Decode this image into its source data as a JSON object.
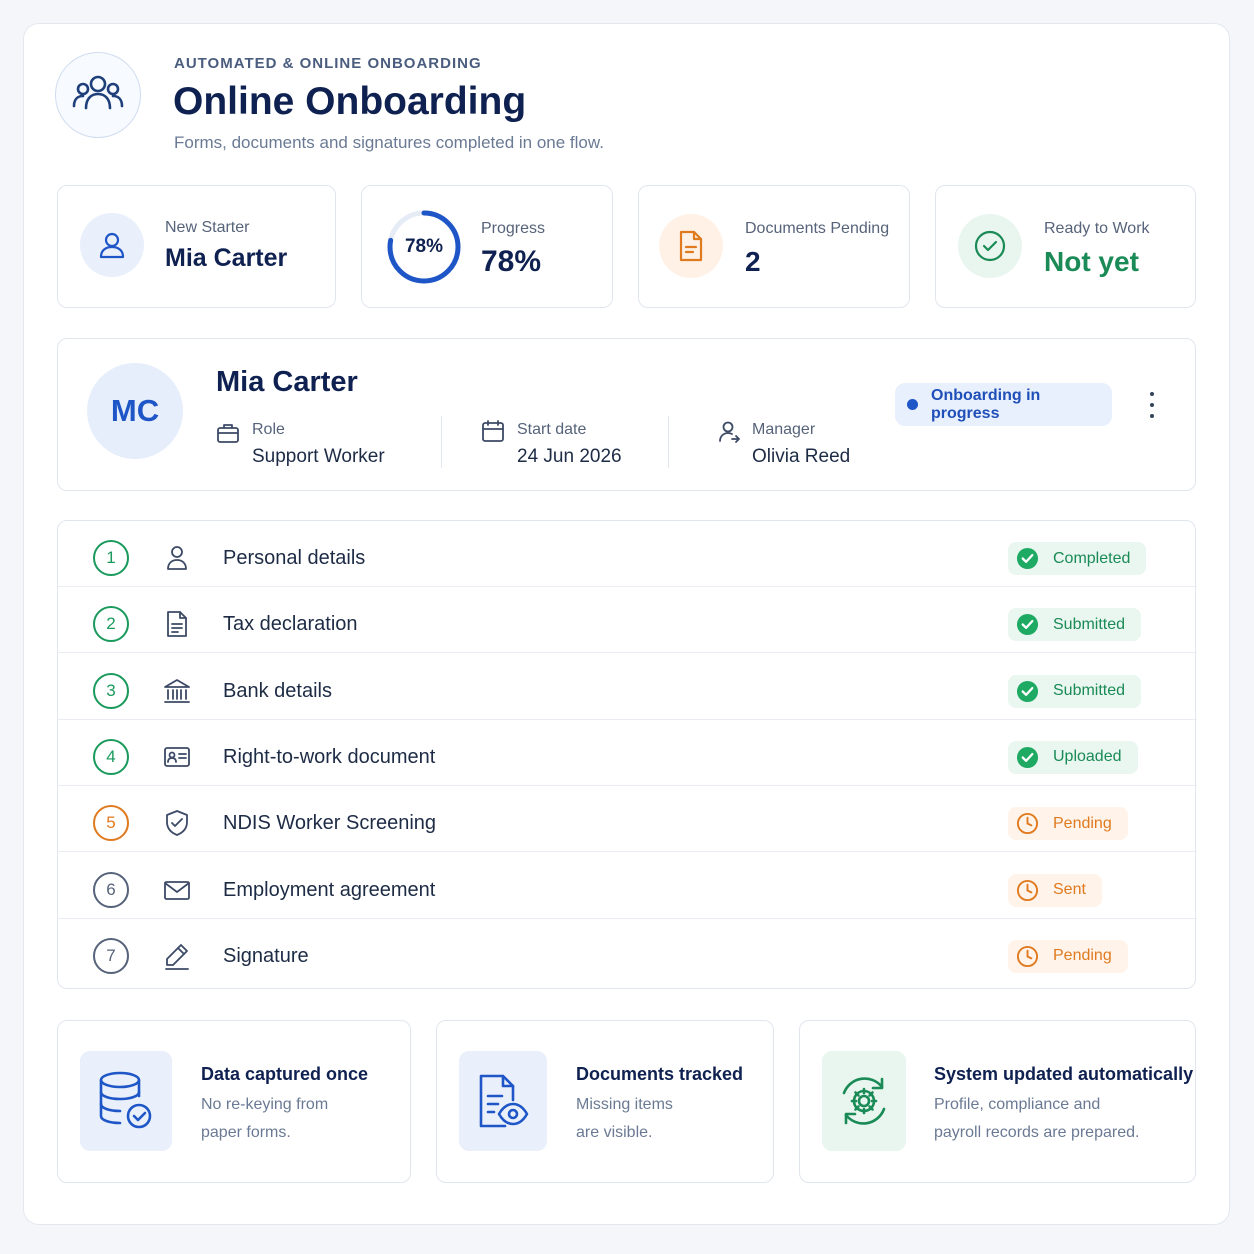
{
  "header": {
    "eyebrow": "AUTOMATED & ONLINE ONBOARDING",
    "title": "Online Onboarding",
    "subtitle": "Forms, documents and signatures completed in one flow.",
    "icon": "users-icon"
  },
  "stats": {
    "new_starter": {
      "label": "New Starter",
      "value": "Mia Carter",
      "icon": "user-icon"
    },
    "progress": {
      "label": "Progress",
      "value": "78%",
      "ring_text": "78%",
      "percent": 78
    },
    "documents": {
      "label": "Documents Pending",
      "value": "2",
      "icon": "document-icon"
    },
    "ready": {
      "label": "Ready to Work",
      "value": "Not yet",
      "icon": "check-circle-icon"
    }
  },
  "profile": {
    "initials": "MC",
    "name": "Mia Carter",
    "role_label": "Role",
    "role": "Support Worker",
    "start_label": "Start date",
    "start": "24 Jun 2026",
    "manager_label": "Manager",
    "manager": "Olivia Reed",
    "status": "Onboarding in progress"
  },
  "steps": [
    {
      "num": "1",
      "label": "Personal details",
      "status": "Completed",
      "state": "ok",
      "icon": "user-icon"
    },
    {
      "num": "2",
      "label": "Tax declaration",
      "status": "Submitted",
      "state": "ok",
      "icon": "document-icon"
    },
    {
      "num": "3",
      "label": "Bank details",
      "status": "Submitted",
      "state": "ok",
      "icon": "bank-icon"
    },
    {
      "num": "4",
      "label": "Right-to-work document",
      "status": "Uploaded",
      "state": "ok",
      "icon": "id-card-icon"
    },
    {
      "num": "5",
      "label": "NDIS Worker Screening",
      "status": "Pending",
      "state": "warn",
      "icon": "shield-check-icon"
    },
    {
      "num": "6",
      "label": "Employment agreement",
      "status": "Sent",
      "state": "warn",
      "icon": "envelope-icon"
    },
    {
      "num": "7",
      "label": "Signature",
      "status": "Pending",
      "state": "warn",
      "icon": "pen-icon"
    }
  ],
  "features": [
    {
      "title": "Data captured once",
      "line1": "No re-keying from",
      "line2": "paper forms.",
      "icon": "database-check-icon"
    },
    {
      "title": "Documents tracked",
      "line1": "Missing items",
      "line2": "are visible.",
      "icon": "document-eye-icon"
    },
    {
      "title": "System updated automatically",
      "line1": "Profile, compliance and",
      "line2": "payroll records are prepared.",
      "icon": "gear-sync-icon"
    }
  ],
  "colors": {
    "brand": "#1f56c7",
    "navy": "#0f2150",
    "success": "#1a8a56",
    "warning": "#e07a1f"
  }
}
